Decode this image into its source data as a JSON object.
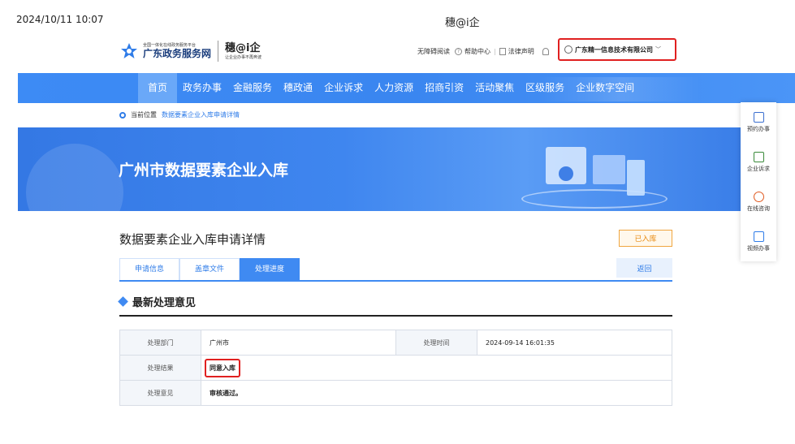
{
  "print": {
    "date": "2024/10/11 10:07",
    "title": "穗@i企"
  },
  "header": {
    "gov_slogan": "全国一体化在线政务服务平台",
    "gov_name": "广东政务服务网",
    "brand": "穗@i企",
    "brand_slogan": "让企业办事不再奔波",
    "links": {
      "accessible": "无障碍阅读",
      "help": "帮助中心",
      "legal": "法律声明"
    },
    "company": "广东精一信息技术有限公司"
  },
  "nav": {
    "items": [
      "首页",
      "政务办事",
      "金融服务",
      "穗政通",
      "企业诉求",
      "人力资源",
      "招商引资",
      "活动聚焦",
      "区级服务",
      "企业数字空间"
    ],
    "active": "首页"
  },
  "breadcrumb": {
    "label": "当前位置",
    "current": "数据要素企业入库申请详情"
  },
  "banner": {
    "title": "广州市数据要素企业入库"
  },
  "side": {
    "items": [
      "预约办事",
      "企业诉求",
      "在线咨询",
      "视频办事"
    ]
  },
  "main": {
    "heading": "数据要素企业入库申请详情",
    "status": "已入库",
    "tabs": [
      "申请信息",
      "盖章文件",
      "处理进度"
    ],
    "active_tab": "处理进度",
    "back_label": "返回",
    "section_title": "最新处理意见",
    "table": {
      "dept_label": "处理部门",
      "dept_value": "广州市",
      "time_label": "处理时间",
      "time_value": "2024-09-14 16:01:35",
      "result_label": "处理结果",
      "result_value": "同意入库",
      "opinion_label": "处理意见",
      "opinion_value": "审核通过。"
    }
  },
  "colors": {
    "primary": "#3f8af2",
    "highlight": "#e02020",
    "status": "#e88a10"
  }
}
